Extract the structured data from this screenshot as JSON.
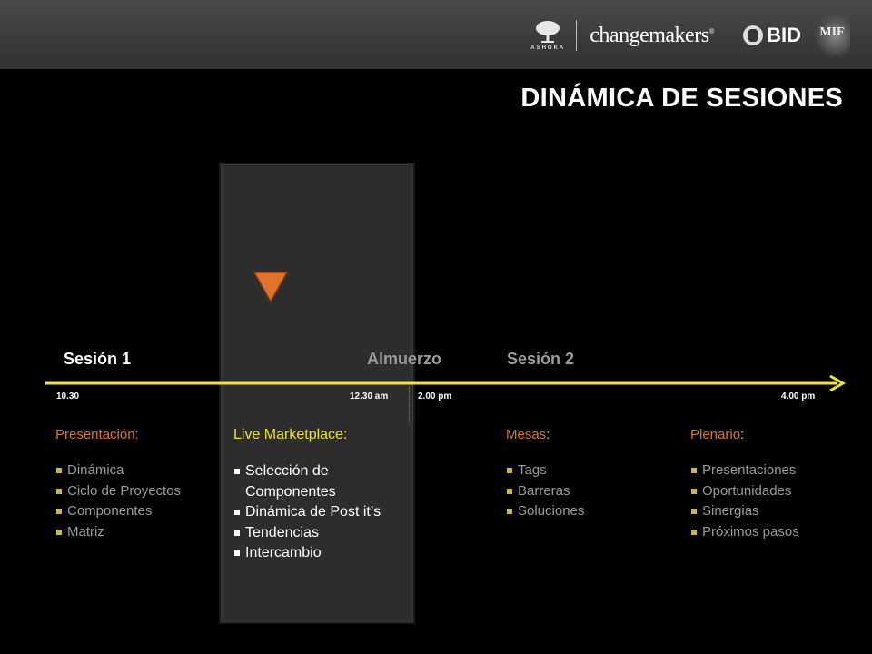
{
  "header": {
    "ashoka_text": "ASHOKA",
    "changemakers_text": "changemakers",
    "bid_text": "BID",
    "mif_text": "MIF"
  },
  "title": "DINÁMICA DE SESIONES",
  "timeline": {
    "labels": {
      "session1": "Sesión 1",
      "lunch": "Almuerzo",
      "session2": "Sesión 2"
    },
    "times": {
      "t1": "10.30",
      "t2": "12.30 am",
      "t3": "2.00 pm",
      "t4": "4.00 pm"
    }
  },
  "columns": [
    {
      "heading": "Presentación:",
      "items": [
        "Dinámica",
        "Ciclo de Proyectos",
        "Componentes",
        "Matriz"
      ]
    },
    {
      "heading": "Live Marketplace:",
      "items": [
        "Selección de Componentes",
        "Dinámica de Post it’s",
        "Tendencias",
        "Intercambio"
      ]
    },
    {
      "heading": "Mesas",
      "items": [
        "Tags",
        "Barreras",
        "Soluciones"
      ]
    },
    {
      "heading": "Plenario",
      "items": [
        "Presentaciones",
        "Oportunidades",
        "Sinergias",
        "Próximos pasos"
      ]
    }
  ],
  "colors": {
    "timeline": "#f2e52a",
    "marker": "#e0722a",
    "accent_heading": "#d17a2a",
    "marketplace_heading": "#ece033"
  },
  "icons": [
    "ashoka-tree-icon",
    "bid-seal-icon",
    "down-triangle-marker-icon",
    "arrow-right-icon"
  ]
}
